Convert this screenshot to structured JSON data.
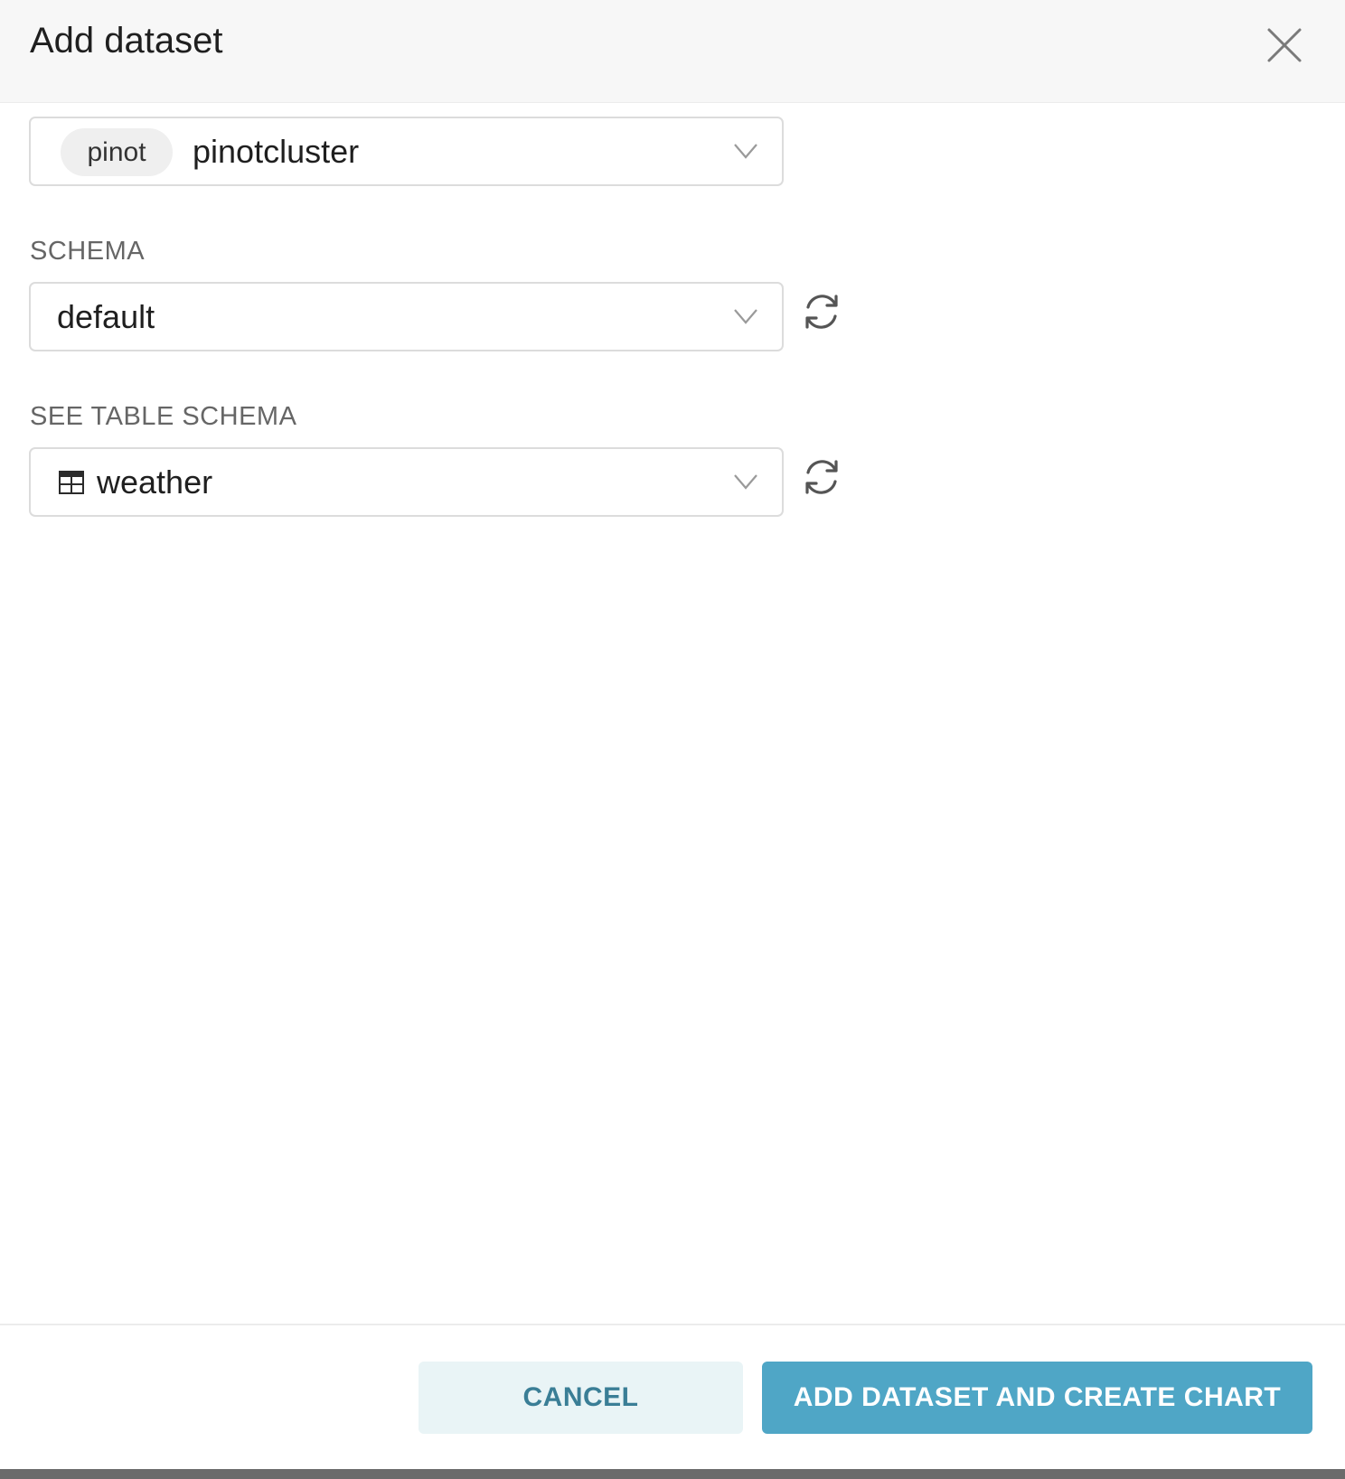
{
  "modal": {
    "title": "Add dataset"
  },
  "database": {
    "engine_tag": "pinot",
    "value": "pinotcluster"
  },
  "schema": {
    "label": "SCHEMA",
    "value": "default"
  },
  "table": {
    "label": "SEE TABLE SCHEMA",
    "value": "weather"
  },
  "footer": {
    "cancel_label": "CANCEL",
    "submit_label": "ADD DATASET AND CREATE CHART"
  },
  "icons": {
    "close": "close-icon",
    "chevron": "chevron-down-icon",
    "refresh": "refresh-icon",
    "table": "table-icon"
  },
  "colors": {
    "primary": "#4fa6c6",
    "secondary_bg": "#e9f4f6",
    "secondary_text": "#3a7e96",
    "header_bg": "#f7f7f7"
  }
}
